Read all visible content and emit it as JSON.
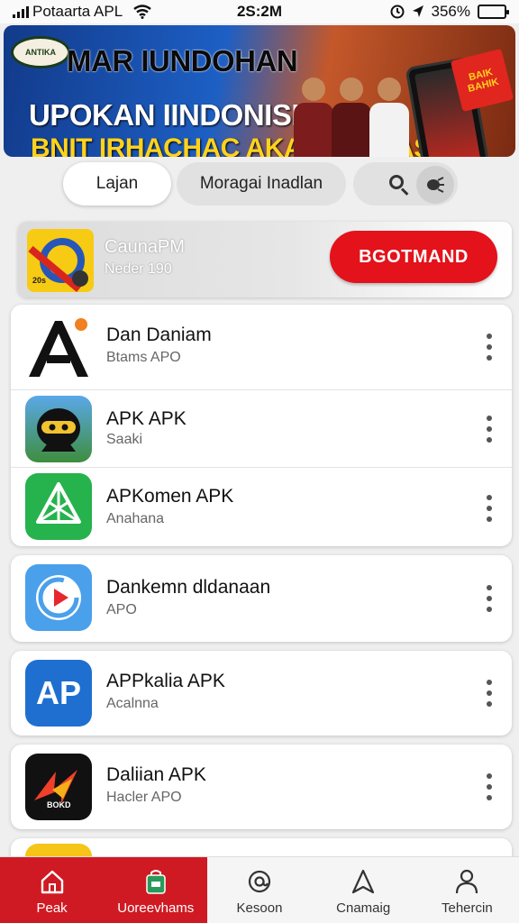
{
  "status_bar": {
    "carrier": "Potaarta APL",
    "time": "2S:2M",
    "battery_percent": "356%"
  },
  "banner": {
    "logo_text": "ANTIKA",
    "line1": "MAR IUNDOHAN",
    "line2": "UPOKAN IINDONISIA",
    "line3": "BNIT IRHACHAC AKAR INONASIA",
    "badge_text": "BAIK BAHIK"
  },
  "tabs": {
    "items": [
      {
        "label": "Lajan",
        "active": true
      },
      {
        "label": "Moragai Inadlan",
        "active": false
      }
    ]
  },
  "featured": {
    "name": "CaunaPM",
    "subtitle": "Neder 190",
    "icon_tag": "20s",
    "download_label": "BGOTMAND"
  },
  "apps": [
    {
      "name": "Dan Daniam",
      "subtitle": "Btams APO",
      "icon": "letter-a-icon"
    },
    {
      "name": "APK APK",
      "subtitle": "Saaki",
      "icon": "ninja-icon"
    },
    {
      "name": "APKomen APK",
      "subtitle": "Anahana",
      "icon": "triangle-shape-icon"
    },
    {
      "name": "Dankemn dldanaan",
      "subtitle": "APO",
      "icon": "play-circle-icon"
    },
    {
      "name": "APPkalia APK",
      "subtitle": "Acalnna",
      "icon": "ap-logo-icon",
      "icon_text": "AP"
    },
    {
      "name": "Daliian APK",
      "subtitle": "Hacler APO",
      "icon": "lightning-icon",
      "icon_text": "BOKD"
    }
  ],
  "bottom_nav": [
    {
      "label": "Peak",
      "icon": "home-icon"
    },
    {
      "label": "Uoreevhams",
      "icon": "bag-icon"
    },
    {
      "label": "Kesoon",
      "icon": "at-icon"
    },
    {
      "label": "Cnamaig",
      "icon": "navigate-icon"
    },
    {
      "label": "Tehercin",
      "icon": "person-icon"
    }
  ],
  "colors": {
    "accent_red": "#d01a23",
    "download_red": "#e3121b",
    "battery_green": "#2bb24c"
  }
}
